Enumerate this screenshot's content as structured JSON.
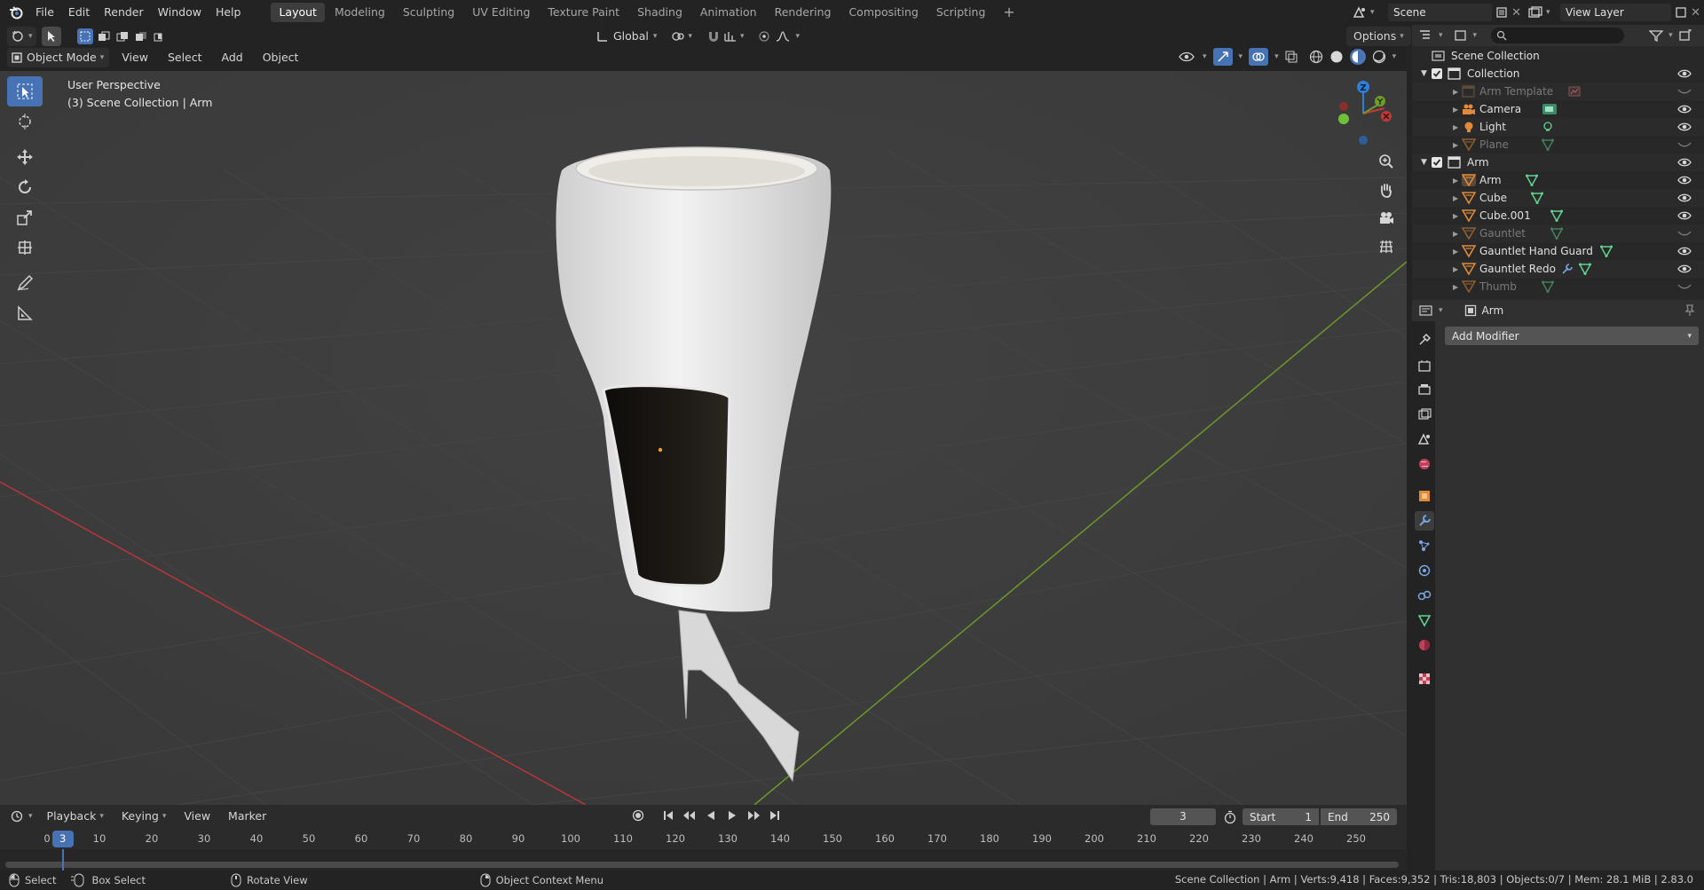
{
  "menu": {
    "items": [
      "File",
      "Edit",
      "Render",
      "Window",
      "Help"
    ]
  },
  "workspaces": {
    "tabs": [
      "Layout",
      "Modeling",
      "Sculpting",
      "UV Editing",
      "Texture Paint",
      "Shading",
      "Animation",
      "Rendering",
      "Compositing",
      "Scripting"
    ],
    "active": "Layout"
  },
  "scene": {
    "name": "Scene",
    "view_layer": "View Layer"
  },
  "header": {
    "transform_orientation": "Global",
    "mode": "Object Mode",
    "menus": [
      "View",
      "Select",
      "Add",
      "Object"
    ],
    "options": "Options"
  },
  "viewport": {
    "perspective": "User Perspective",
    "context": "(3) Scene Collection | Arm",
    "gizmo_z": "Z"
  },
  "outliner": {
    "root": "Scene Collection",
    "rows": [
      {
        "name": "Collection",
        "kind": "collection",
        "dim": false
      },
      {
        "name": "Arm Template",
        "kind": "object",
        "dim": true
      },
      {
        "name": "Camera",
        "kind": "camera",
        "dim": false
      },
      {
        "name": "Light",
        "kind": "light",
        "dim": false
      },
      {
        "name": "Plane",
        "kind": "mesh",
        "dim": true
      },
      {
        "name": "Arm",
        "kind": "collection",
        "dim": false
      },
      {
        "name": "Arm",
        "kind": "mesh",
        "dim": false
      },
      {
        "name": "Cube",
        "kind": "mesh",
        "dim": false
      },
      {
        "name": "Cube.001",
        "kind": "mesh",
        "dim": false
      },
      {
        "name": "Gauntlet",
        "kind": "mesh",
        "dim": true
      },
      {
        "name": "Gauntlet Hand Guard",
        "kind": "mesh",
        "dim": false
      },
      {
        "name": "Gauntlet Redo",
        "kind": "mesh",
        "dim": false
      },
      {
        "name": "Thumb",
        "kind": "mesh",
        "dim": true
      }
    ]
  },
  "properties": {
    "object": "Arm",
    "add_modifier": "Add Modifier"
  },
  "timeline": {
    "menus": [
      "Playback",
      "Keying",
      "View",
      "Marker"
    ],
    "current_frame": "3",
    "start_label": "Start",
    "start": "1",
    "end_label": "End",
    "end": "250",
    "ruler": [
      "0",
      "10",
      "20",
      "30",
      "40",
      "50",
      "60",
      "70",
      "80",
      "90",
      "100",
      "110",
      "120",
      "130",
      "140",
      "150",
      "160",
      "170",
      "180",
      "190",
      "200",
      "210",
      "220",
      "230",
      "240",
      "250"
    ]
  },
  "status": {
    "select": "Select",
    "box_select": "Box Select",
    "rotate_view": "Rotate View",
    "context_menu": "Object Context Menu",
    "stats": "Scene Collection | Arm | Verts:9,418 | Faces:9,352 | Tris:18,803 | Objects:0/7 | Mem: 28.1 MiB | 2.83.0"
  },
  "colors": {
    "accent": "#4772b3",
    "x_axis": "#c33a3a",
    "y_axis": "#6f9c2a",
    "z_axis": "#2e7fd8",
    "mesh_orange": "#e08a3a",
    "data_green": "#5fd38f"
  }
}
